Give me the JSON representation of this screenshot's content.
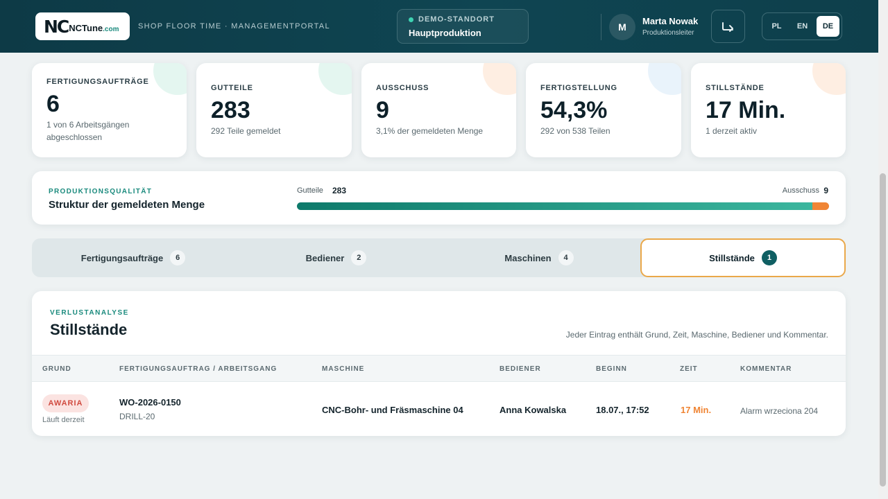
{
  "header": {
    "logo": {
      "mark": "NC",
      "name": "NCTune",
      "domain": ".com"
    },
    "subtitle": "SHOP FLOOR TIME · MANAGEMENTPORTAL",
    "site": {
      "label": "DEMO-STANDORT",
      "name": "Hauptproduktion"
    },
    "user": {
      "initial": "M",
      "name": "Marta Nowak",
      "role": "Produktionsleiter"
    },
    "languages": [
      "PL",
      "EN",
      "DE"
    ],
    "active_language": "DE"
  },
  "kpis": [
    {
      "label": "FERTIGUNGSAUFTRÄGE",
      "value": "6",
      "sub": "1 von 6 Arbeitsgängen abgeschlossen",
      "accent": "#cdeee3"
    },
    {
      "label": "GUTTEILE",
      "value": "283",
      "sub": "292 Teile gemeldet",
      "accent": "#cdeee3"
    },
    {
      "label": "AUSSCHUSS",
      "value": "9",
      "sub": "3,1% der gemeldeten Menge",
      "accent": "#fde0cb"
    },
    {
      "label": "FERTIGSTELLUNG",
      "value": "54,3%",
      "sub": "292 von 538 Teilen",
      "accent": "#d7e9f7"
    },
    {
      "label": "STILLSTÄNDE",
      "value": "17 Min.",
      "sub": "1 derzeit aktiv",
      "accent": "#fde0cb"
    }
  ],
  "quality": {
    "eyebrow": "PRODUKTIONSQUALITÄT",
    "title": "Struktur der gemeldeten Menge",
    "good_label": "Gutteile",
    "good_value": "283",
    "bad_label": "Ausschuss",
    "bad_value": "9",
    "good_count": 283,
    "bad_count": 9
  },
  "tabs": [
    {
      "label": "Fertigungsaufträge",
      "count": "6"
    },
    {
      "label": "Bediener",
      "count": "2"
    },
    {
      "label": "Maschinen",
      "count": "4"
    },
    {
      "label": "Stillstände",
      "count": "1"
    }
  ],
  "active_tab": "Stillstände",
  "downtime": {
    "eyebrow": "VERLUSTANALYSE",
    "title": "Stillstände",
    "hint": "Jeder Eintrag enthält Grund, Zeit, Maschine, Bediener und Kommentar.",
    "columns": [
      "GRUND",
      "FERTIGUNGSAUFTRAG / ARBEITSGANG",
      "MASCHINE",
      "BEDIENER",
      "BEGINN",
      "ZEIT",
      "KOMMENTAR"
    ],
    "rows": [
      {
        "reason": "AWARIA",
        "reason_status": "Läuft derzeit",
        "order": "WO-2026-0150",
        "operation": "DRILL-20",
        "machine": "CNC-Bohr- und Fräsmaschine 04",
        "operator": "Anna Kowalska",
        "start": "18.07., 17:52",
        "duration": "17 Min.",
        "comment": "Alarm wrzeciona 204"
      }
    ]
  },
  "colors": {
    "brand": "#0f4552",
    "accent_teal": "#1a8a7d",
    "warning": "#f08534",
    "tab_highlight": "#eaa84a"
  }
}
